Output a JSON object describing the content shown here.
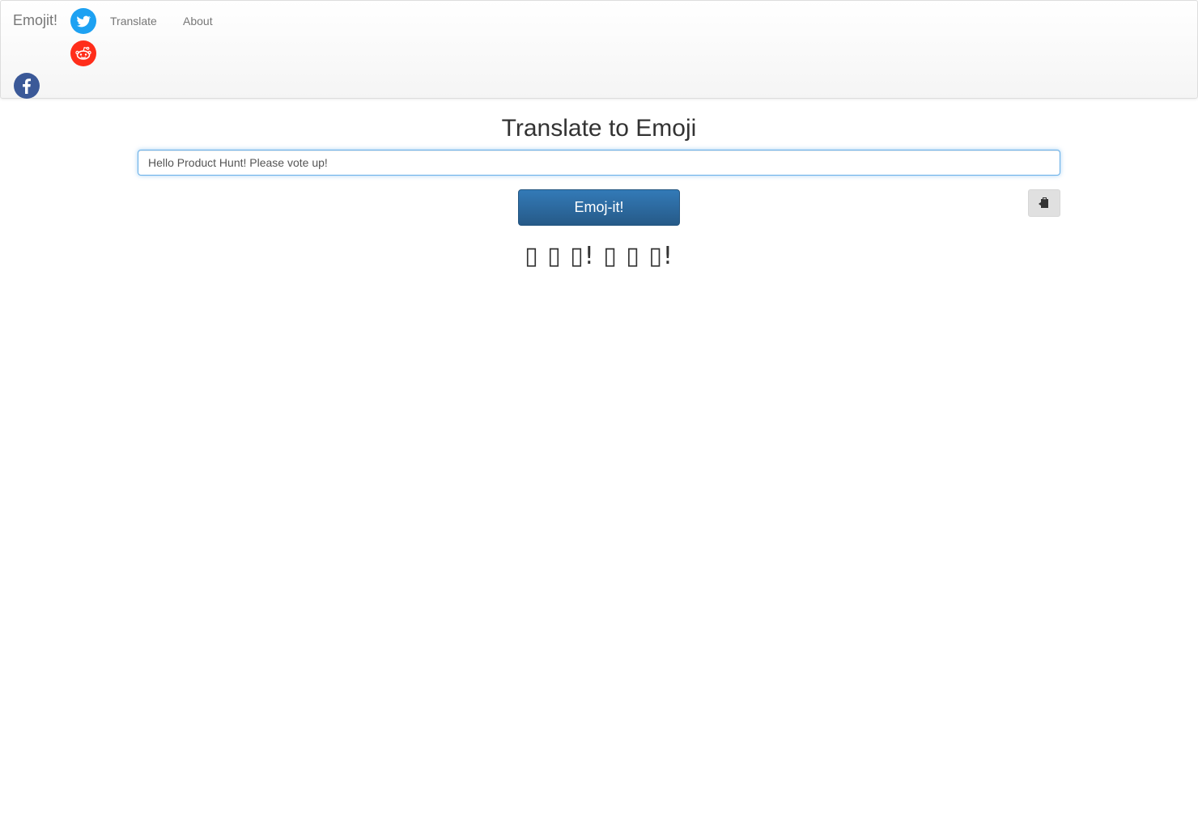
{
  "navbar": {
    "brand": "Emojit!",
    "links": [
      {
        "label": "Translate"
      },
      {
        "label": "About"
      }
    ],
    "social": [
      {
        "name": "twitter",
        "icon": "twitter-icon",
        "color": "#1da1f2"
      },
      {
        "name": "reddit",
        "icon": "reddit-icon",
        "color": "#ff4500"
      },
      {
        "name": "facebook",
        "icon": "facebook-icon",
        "color": "#3b5998"
      }
    ]
  },
  "main": {
    "title": "Translate to Emoji",
    "input_value": "Hello Product Hunt! Please vote up!",
    "submit_label": "Emoj-it!",
    "copy_icon": "clipboard-icon",
    "result": "▯ ▯ ▯! ▯ ▯ ▯!"
  },
  "colors": {
    "primary_button": "#337ab7",
    "input_focus_border": "#66afe9"
  }
}
